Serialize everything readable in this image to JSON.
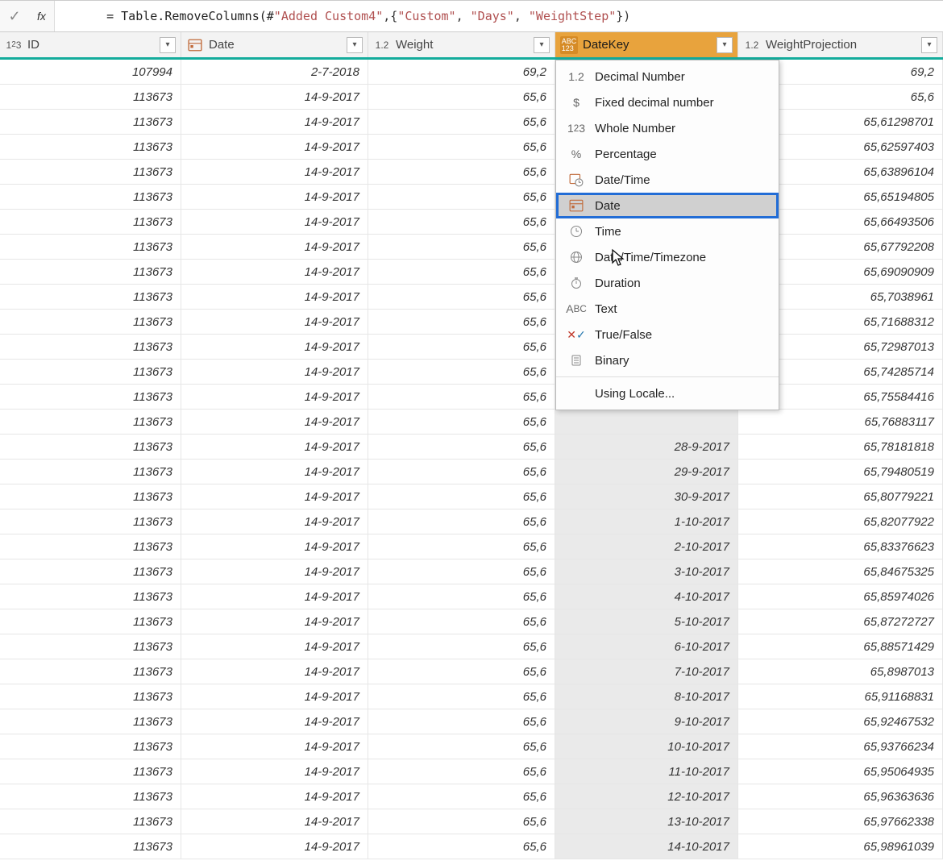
{
  "formula_bar": {
    "fx_label": "fx",
    "prefix": "= Table.RemoveColumns(#",
    "step_ref": "\"Added Custom4\"",
    "mid": ",{",
    "col1": "\"Custom\"",
    "sep": ", ",
    "col2": "\"Days\"",
    "col3": "\"WeightStep\"",
    "suffix": "})"
  },
  "columns": {
    "id": {
      "label": "ID",
      "type_icon": "int"
    },
    "date": {
      "label": "Date",
      "type_icon": "date"
    },
    "weight": {
      "label": "Weight",
      "type_icon": "decimal"
    },
    "datekey": {
      "label": "DateKey",
      "type_icon": "any"
    },
    "wp": {
      "label": "WeightProjection",
      "type_icon": "decimal"
    }
  },
  "type_menu": {
    "decimal": "Decimal Number",
    "fixed": "Fixed decimal number",
    "whole": "Whole Number",
    "percent": "Percentage",
    "datetime": "Date/Time",
    "date": "Date",
    "time": "Time",
    "dtz": "Date/Time/Timezone",
    "duration": "Duration",
    "text": "Text",
    "bool": "True/False",
    "binary": "Binary",
    "locale": "Using Locale..."
  },
  "rows": [
    {
      "id": "107994",
      "date": "2-7-2018",
      "weight": "69,2",
      "datekey": "",
      "wp": "69,2"
    },
    {
      "id": "113673",
      "date": "14-9-2017",
      "weight": "65,6",
      "datekey": "",
      "wp": "65,6"
    },
    {
      "id": "113673",
      "date": "14-9-2017",
      "weight": "65,6",
      "datekey": "",
      "wp": "65,61298701"
    },
    {
      "id": "113673",
      "date": "14-9-2017",
      "weight": "65,6",
      "datekey": "",
      "wp": "65,62597403"
    },
    {
      "id": "113673",
      "date": "14-9-2017",
      "weight": "65,6",
      "datekey": "",
      "wp": "65,63896104"
    },
    {
      "id": "113673",
      "date": "14-9-2017",
      "weight": "65,6",
      "datekey": "",
      "wp": "65,65194805"
    },
    {
      "id": "113673",
      "date": "14-9-2017",
      "weight": "65,6",
      "datekey": "",
      "wp": "65,66493506"
    },
    {
      "id": "113673",
      "date": "14-9-2017",
      "weight": "65,6",
      "datekey": "",
      "wp": "65,67792208"
    },
    {
      "id": "113673",
      "date": "14-9-2017",
      "weight": "65,6",
      "datekey": "",
      "wp": "65,69090909"
    },
    {
      "id": "113673",
      "date": "14-9-2017",
      "weight": "65,6",
      "datekey": "",
      "wp": "65,7038961"
    },
    {
      "id": "113673",
      "date": "14-9-2017",
      "weight": "65,6",
      "datekey": "",
      "wp": "65,71688312"
    },
    {
      "id": "113673",
      "date": "14-9-2017",
      "weight": "65,6",
      "datekey": "",
      "wp": "65,72987013"
    },
    {
      "id": "113673",
      "date": "14-9-2017",
      "weight": "65,6",
      "datekey": "",
      "wp": "65,74285714"
    },
    {
      "id": "113673",
      "date": "14-9-2017",
      "weight": "65,6",
      "datekey": "",
      "wp": "65,75584416"
    },
    {
      "id": "113673",
      "date": "14-9-2017",
      "weight": "65,6",
      "datekey": "",
      "wp": "65,76883117"
    },
    {
      "id": "113673",
      "date": "14-9-2017",
      "weight": "65,6",
      "datekey": "28-9-2017",
      "wp": "65,78181818"
    },
    {
      "id": "113673",
      "date": "14-9-2017",
      "weight": "65,6",
      "datekey": "29-9-2017",
      "wp": "65,79480519"
    },
    {
      "id": "113673",
      "date": "14-9-2017",
      "weight": "65,6",
      "datekey": "30-9-2017",
      "wp": "65,80779221"
    },
    {
      "id": "113673",
      "date": "14-9-2017",
      "weight": "65,6",
      "datekey": "1-10-2017",
      "wp": "65,82077922"
    },
    {
      "id": "113673",
      "date": "14-9-2017",
      "weight": "65,6",
      "datekey": "2-10-2017",
      "wp": "65,83376623"
    },
    {
      "id": "113673",
      "date": "14-9-2017",
      "weight": "65,6",
      "datekey": "3-10-2017",
      "wp": "65,84675325"
    },
    {
      "id": "113673",
      "date": "14-9-2017",
      "weight": "65,6",
      "datekey": "4-10-2017",
      "wp": "65,85974026"
    },
    {
      "id": "113673",
      "date": "14-9-2017",
      "weight": "65,6",
      "datekey": "5-10-2017",
      "wp": "65,87272727"
    },
    {
      "id": "113673",
      "date": "14-9-2017",
      "weight": "65,6",
      "datekey": "6-10-2017",
      "wp": "65,88571429"
    },
    {
      "id": "113673",
      "date": "14-9-2017",
      "weight": "65,6",
      "datekey": "7-10-2017",
      "wp": "65,8987013"
    },
    {
      "id": "113673",
      "date": "14-9-2017",
      "weight": "65,6",
      "datekey": "8-10-2017",
      "wp": "65,91168831"
    },
    {
      "id": "113673",
      "date": "14-9-2017",
      "weight": "65,6",
      "datekey": "9-10-2017",
      "wp": "65,92467532"
    },
    {
      "id": "113673",
      "date": "14-9-2017",
      "weight": "65,6",
      "datekey": "10-10-2017",
      "wp": "65,93766234"
    },
    {
      "id": "113673",
      "date": "14-9-2017",
      "weight": "65,6",
      "datekey": "11-10-2017",
      "wp": "65,95064935"
    },
    {
      "id": "113673",
      "date": "14-9-2017",
      "weight": "65,6",
      "datekey": "12-10-2017",
      "wp": "65,96363636"
    },
    {
      "id": "113673",
      "date": "14-9-2017",
      "weight": "65,6",
      "datekey": "13-10-2017",
      "wp": "65,97662338"
    },
    {
      "id": "113673",
      "date": "14-9-2017",
      "weight": "65,6",
      "datekey": "14-10-2017",
      "wp": "65,98961039"
    }
  ]
}
